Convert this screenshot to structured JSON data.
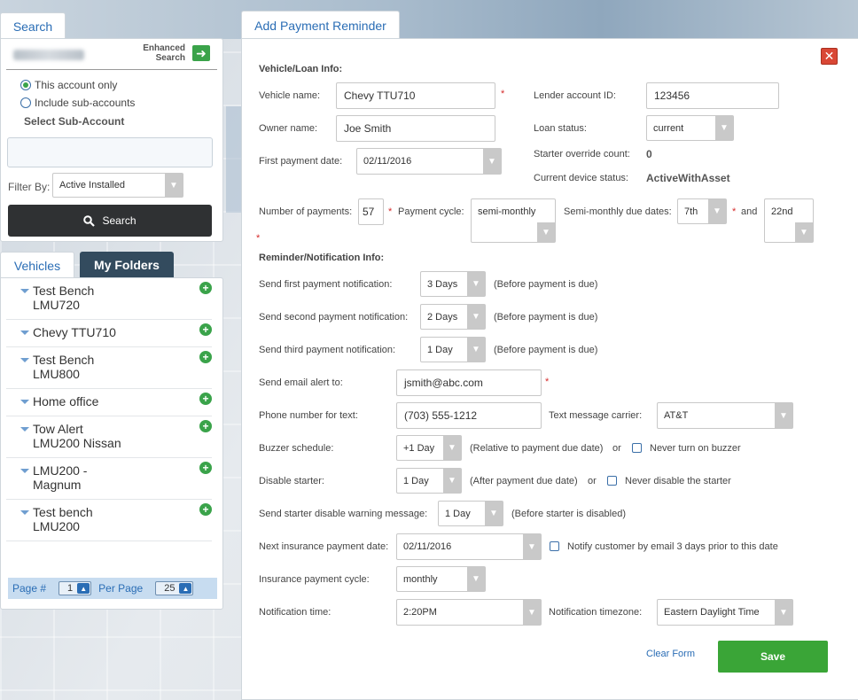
{
  "left": {
    "search_tab": "Search",
    "enhanced_line1": "Enhanced",
    "enhanced_line2": "Search",
    "radio_this": "This account only",
    "radio_include": "Include sub-accounts",
    "select_sub": "Select Sub-Account",
    "filter_by": "Filter By:",
    "filter_value": "Active Installed",
    "search_button": "Search",
    "vehicles_tab": "Vehicles",
    "folders_tab": "My Folders",
    "vehicles": [
      {
        "line1": "Test Bench",
        "line2": "LMU720"
      },
      {
        "line1": "Chevy TTU710",
        "line2": ""
      },
      {
        "line1": "Test Bench",
        "line2": "LMU800"
      },
      {
        "line1": "Home office",
        "line2": ""
      },
      {
        "line1": "Tow Alert",
        "line2": "LMU200 Nissan"
      },
      {
        "line1": "LMU200 -",
        "line2": "Magnum"
      },
      {
        "line1": "Test bench",
        "line2": "LMU200"
      }
    ],
    "pager": {
      "page_label": "Page #",
      "page": "1",
      "per_page_label": "Per Page",
      "per_page": "25"
    }
  },
  "form": {
    "tab": "Add Payment Reminder",
    "vehicle_section": "Vehicle/Loan Info:",
    "vehicle_name_label": "Vehicle name:",
    "vehicle_name": "Chevy  TTU710",
    "owner_name_label": "Owner name:",
    "owner_name": "Joe Smith",
    "first_payment_label": "First payment date:",
    "first_payment": "02/11/2016",
    "lender_label": "Lender account ID:",
    "lender_id": "123456",
    "loan_status_label": "Loan status:",
    "loan_status": "current",
    "override_label": "Starter override count:",
    "override_count": "0",
    "device_status_label": "Current device status:",
    "device_status": "ActiveWithAsset",
    "num_payments_label": "Number of payments:",
    "num_payments": "57",
    "cycle_label": "Payment cycle:",
    "cycle": "semi-monthly",
    "semi_due_label": "Semi-monthly due dates:",
    "due1": "7th",
    "and_label": "and",
    "due2": "22nd",
    "reminder_section": "Reminder/Notification Info:",
    "first_notif_label": "Send first payment notification:",
    "first_notif": "3 Days",
    "second_notif_label": "Send second payment notification:",
    "second_notif": "2 Days",
    "third_notif_label": "Send third payment notification:",
    "third_notif": "1 Day",
    "before_due": "(Before payment is due)",
    "email_label": "Send email alert to:",
    "email": "jsmith@abc.com",
    "phone_label": "Phone number for text:",
    "phone": "(703) 555-1212",
    "carrier_label": "Text message carrier:",
    "carrier": "AT&T",
    "buzzer_label": "Buzzer schedule:",
    "buzzer": "+1 Day",
    "buzzer_note": "(Relative to payment due date)",
    "or": "or",
    "never_buzzer": "Never turn on buzzer",
    "disable_label": "Disable starter:",
    "disable": "1 Day",
    "disable_note": "(After payment due date)",
    "never_disable": "Never disable the starter",
    "warn_label": "Send starter disable warning message:",
    "warn": "1 Day",
    "warn_note": "(Before starter is disabled)",
    "ins_date_label": "Next insurance payment date:",
    "ins_date": "02/11/2016",
    "notify_ins": "Notify customer by email 3 days prior to this date",
    "ins_cycle_label": "Insurance payment cycle:",
    "ins_cycle": "monthly",
    "notif_time_label": "Notification time:",
    "notif_time": "2:20PM",
    "tz_label": "Notification timezone:",
    "tz": "Eastern Daylight Time",
    "clear_form": "Clear Form",
    "save": "Save"
  },
  "colors": {
    "accent_blue": "#2a6db5",
    "save_green": "#3aa537",
    "close_red": "#d94735",
    "folders_tab": "#334b5e"
  },
  "icons": [
    "arrow-right-icon",
    "search-icon",
    "plus-circle-icon",
    "caret-down-icon",
    "close-icon",
    "chevron-down-icon",
    "chevron-up-icon"
  ]
}
